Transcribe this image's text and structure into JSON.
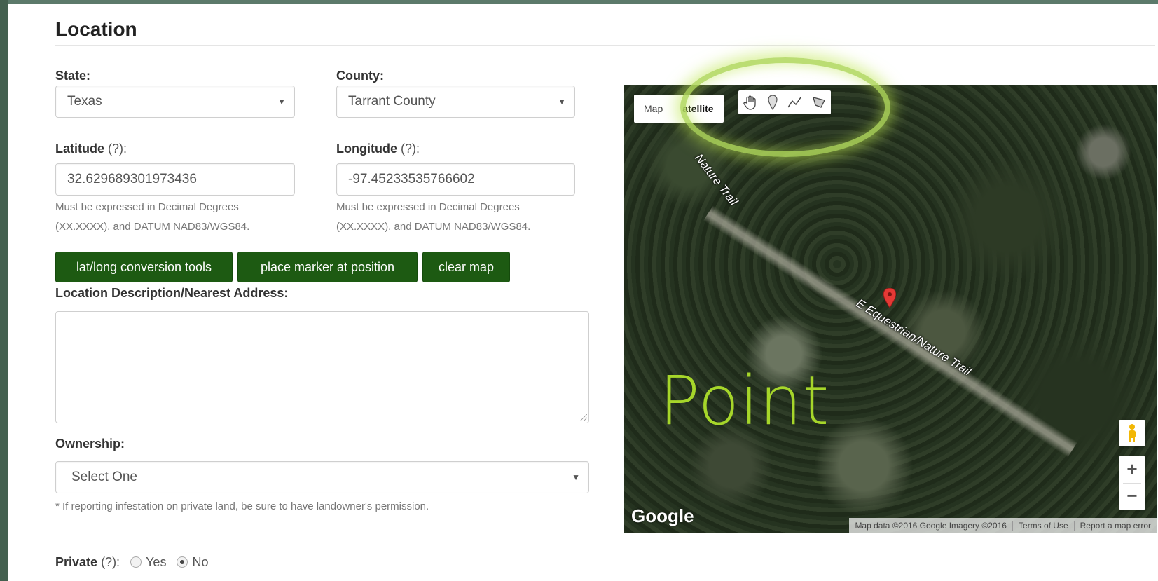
{
  "section": {
    "title": "Location"
  },
  "state": {
    "label": "State:",
    "value": "Texas"
  },
  "county": {
    "label": "County:",
    "value": "Tarrant County"
  },
  "latitude": {
    "label": "Latitude",
    "hint": "(?):",
    "value": "32.629689301973436",
    "help_line1": "Must be expressed in Decimal Degrees",
    "help_line2": "(XX.XXXX), and DATUM NAD83/WGS84."
  },
  "longitude": {
    "label": "Longitude",
    "hint": "(?):",
    "value": "-97.45233535766602",
    "help_line1": "Must be expressed in Decimal Degrees",
    "help_line2": "(XX.XXXX), and DATUM NAD83/WGS84."
  },
  "buttons": {
    "conversion": "lat/long conversion tools",
    "place_marker": "place marker at position",
    "clear_map": "clear map"
  },
  "description": {
    "label": "Location Description/Nearest Address:",
    "value": ""
  },
  "ownership": {
    "label": "Ownership:",
    "value": "Select One",
    "note": "* If reporting infestation on private land, be sure to have landowner's permission."
  },
  "private": {
    "label": "Private",
    "hint": "(?):",
    "yes": "Yes",
    "no": "No",
    "selected": "No"
  },
  "map": {
    "type_map": "Map",
    "type_satellite": "atellite",
    "trail_label_1": "Nature Trail",
    "trail_label_2": "E Equestrian/Nature Trail",
    "overlay_label": "Point",
    "google": "Google",
    "attribution": "Map data ©2016 Google Imagery ©2016",
    "terms": "Terms of Use",
    "report": "Report a map error",
    "zoom_in": "+",
    "zoom_out": "−",
    "tools": [
      "hand-icon",
      "marker-icon",
      "line-icon",
      "polygon-icon"
    ],
    "highlight_color": "#afd75a",
    "marker_color": "#e53935"
  },
  "colors": {
    "button_green": "#1d5a12",
    "point_green": "#a6d62a"
  }
}
